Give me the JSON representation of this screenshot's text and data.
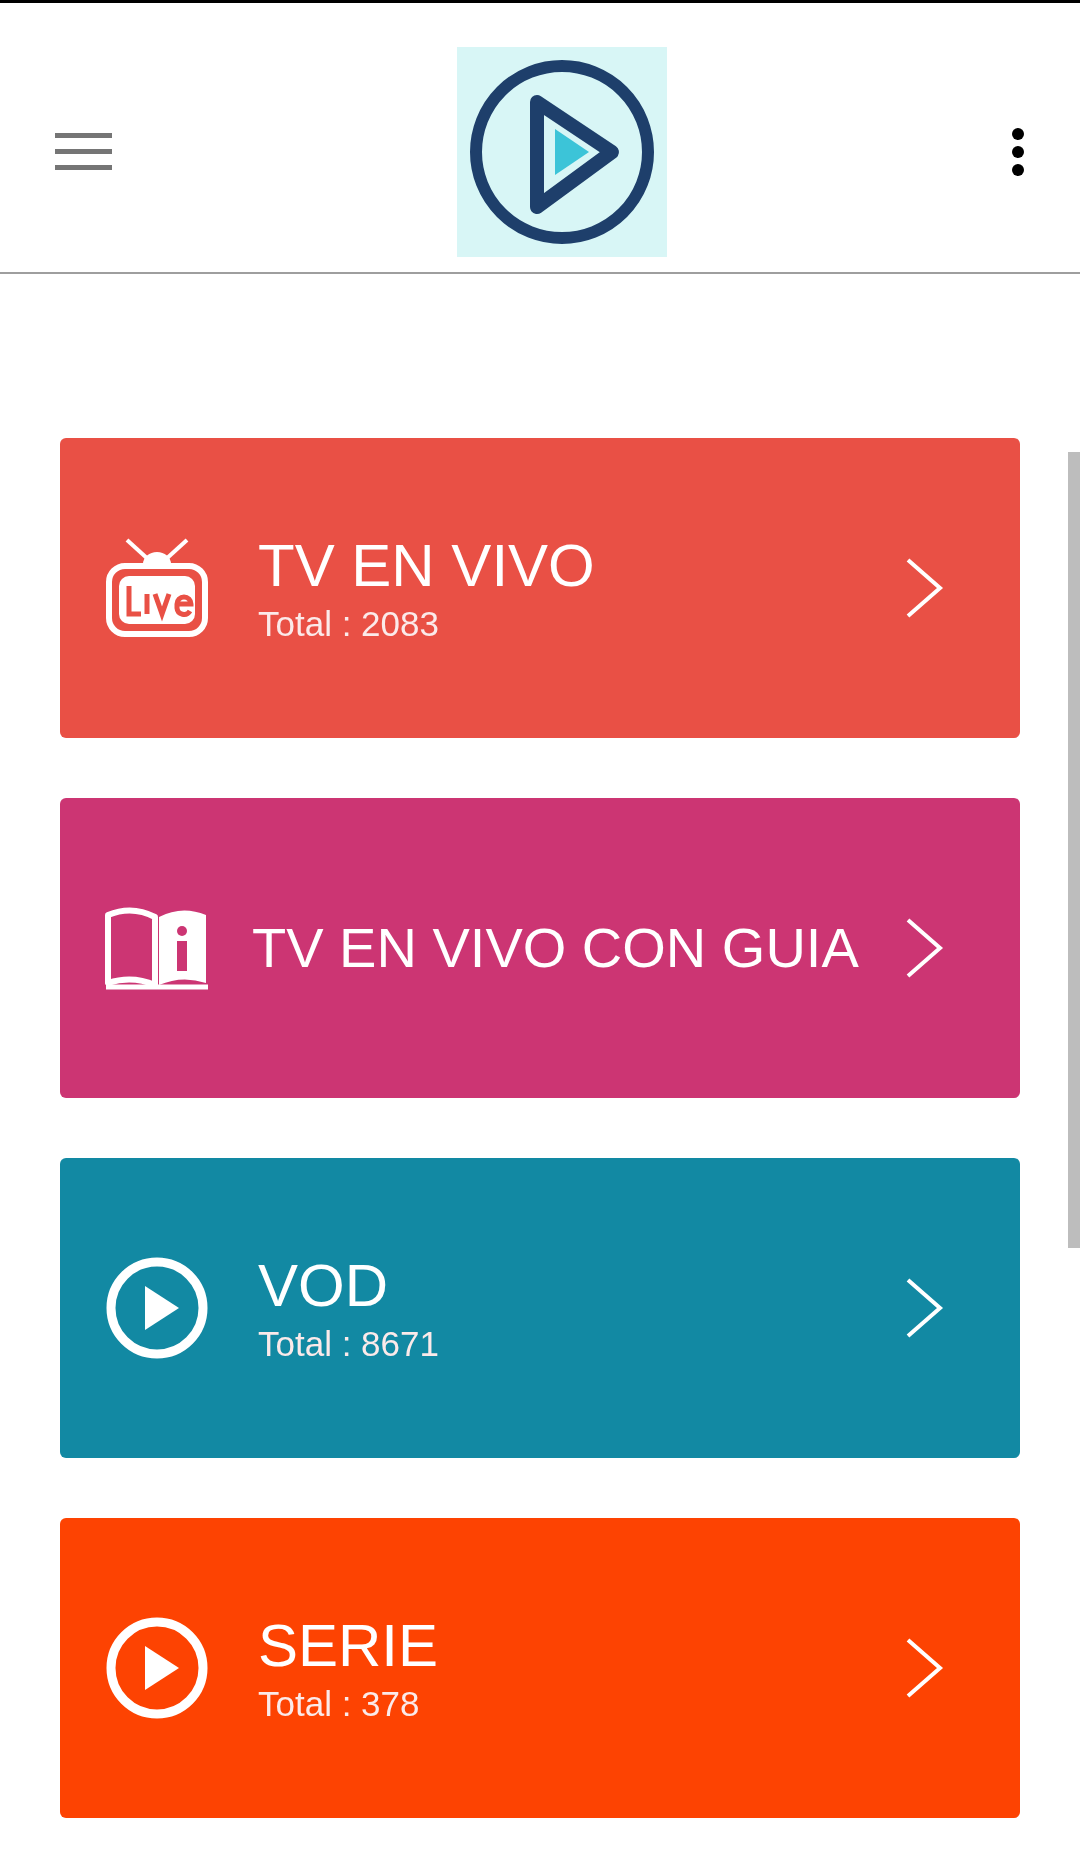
{
  "categories": [
    {
      "kind": "live",
      "title": "TV EN VIVO",
      "total": "Total : 2083",
      "color": "#e95045"
    },
    {
      "kind": "guide",
      "title": "TV EN VIVO CON GUIA",
      "color": "#cc3573"
    },
    {
      "kind": "play",
      "title": "VOD",
      "total": "Total : 8671",
      "color": "#1289a3"
    },
    {
      "kind": "play",
      "title": "SERIE",
      "total": "Total : 378",
      "color": "#fd4302"
    }
  ]
}
